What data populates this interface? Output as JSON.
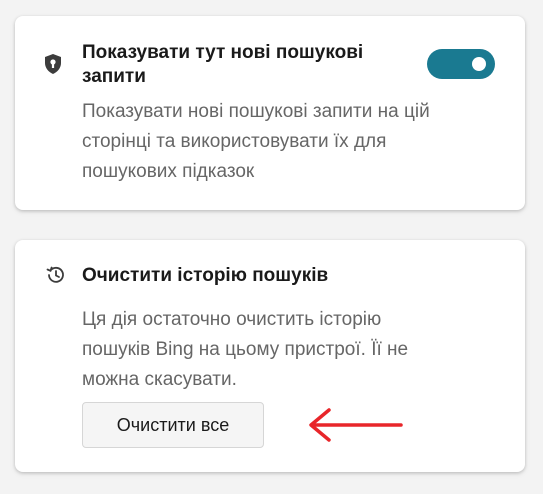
{
  "settings": {
    "show_new_searches": {
      "icon": "shield-lock-icon",
      "title": "Показувати тут нові пошукові запити",
      "description": "Показувати нові пошукові запити на цій сторінці та використовувати їх для пошукових підказок",
      "toggle_on": true,
      "toggle_color": "#1a7a91"
    },
    "clear_history": {
      "icon": "history-icon",
      "title": "Очистити історію пошуків",
      "description": "Ця дія остаточно очистить історію пошуків Bing на цьому пристрої. Її не можна скасувати.",
      "button_label": "Очистити все"
    }
  },
  "annotation": {
    "icon": "red-arrow-icon",
    "color": "#e8262a"
  }
}
